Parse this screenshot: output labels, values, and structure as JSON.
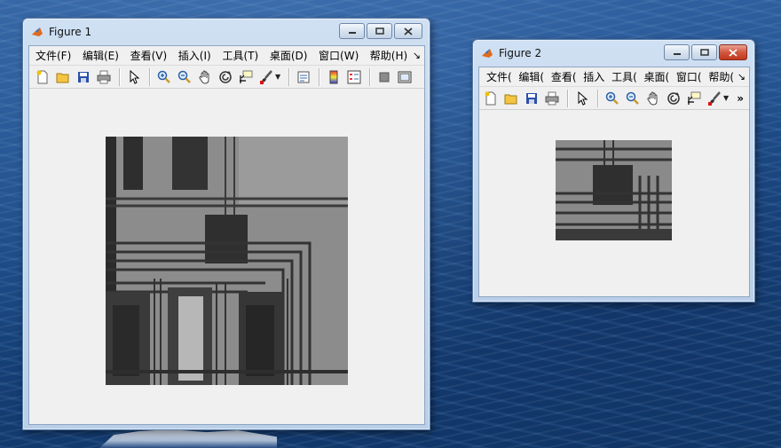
{
  "figure1": {
    "title": "Figure 1",
    "menus": [
      "文件(F)",
      "编辑(E)",
      "查看(V)",
      "插入(I)",
      "工具(T)",
      "桌面(D)",
      "窗口(W)",
      "帮助(H)"
    ],
    "menu_overflow": "↘"
  },
  "figure2": {
    "title": "Figure 2",
    "menus": [
      "文件(",
      "编辑(",
      "查看(",
      "插入",
      "工具(",
      "桌面(",
      "窗口(",
      "帮助("
    ],
    "menu_overflow": "↘",
    "toolbar_overflow": "»"
  },
  "toolbar_icons": [
    "new-figure-icon",
    "open-file-icon",
    "save-icon",
    "print-icon",
    "select-arrow-icon",
    "zoom-in-icon",
    "zoom-out-icon",
    "pan-hand-icon",
    "rotate-3d-icon",
    "data-cursor-icon",
    "brush-icon",
    "link-plot-icon",
    "colorbar-icon",
    "legend-icon",
    "hide-plot-tools-icon",
    "show-plot-tools-icon"
  ],
  "colors": {
    "window_frame": "#b9cfe8",
    "client_bg": "#f0f0f0",
    "close_active": "#c3371d"
  }
}
